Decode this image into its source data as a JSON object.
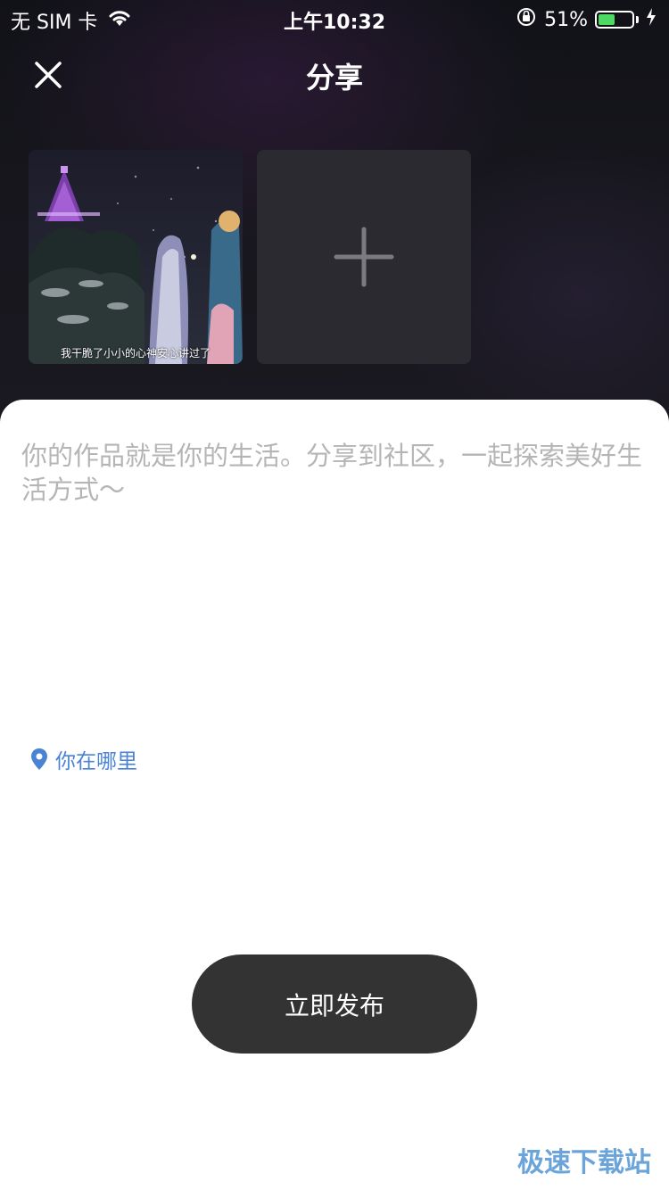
{
  "status_bar": {
    "carrier": "无 SIM 卡",
    "time": "上午10:32",
    "battery_percent": "51%",
    "battery_level": 0.51,
    "icons": [
      "wifi-icon",
      "orientation-lock-icon",
      "battery-icon",
      "charging-icon"
    ]
  },
  "header": {
    "title": "分享",
    "close_icon": "close-icon"
  },
  "media": {
    "images": [
      {
        "caption": "我干脆了小小的心神安心讲过了"
      }
    ],
    "add_icon": "plus-icon"
  },
  "composer": {
    "placeholder": "你的作品就是你的生活。分享到社区，一起探索美好生活方式～",
    "value": ""
  },
  "location": {
    "label": "你在哪里",
    "icon": "location-pin-icon"
  },
  "actions": {
    "publish_label": "立即发布"
  },
  "watermark": "极速下载站",
  "colors": {
    "accent_link": "#4a82d6",
    "button_bg": "#333333",
    "battery_green": "#4cd964"
  }
}
